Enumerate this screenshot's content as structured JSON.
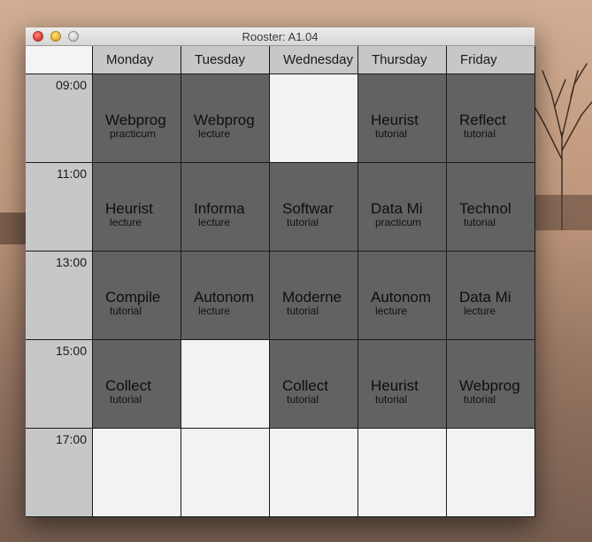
{
  "window": {
    "title": "Rooster: A1.04"
  },
  "days": [
    "Monday",
    "Tuesday",
    "Wednesday",
    "Thursday",
    "Friday"
  ],
  "times": [
    "09:00",
    "11:00",
    "13:00",
    "15:00",
    "17:00"
  ],
  "schedule": [
    [
      {
        "course": "Webprog",
        "kind": "practicum"
      },
      {
        "course": "Webprog",
        "kind": "lecture"
      },
      null,
      {
        "course": "Heurist",
        "kind": "tutorial"
      },
      {
        "course": "Reflect",
        "kind": "tutorial"
      }
    ],
    [
      {
        "course": "Heurist",
        "kind": "lecture"
      },
      {
        "course": "Informa",
        "kind": "lecture"
      },
      {
        "course": "Softwar",
        "kind": "tutorial"
      },
      {
        "course": "Data Mi",
        "kind": "practicum"
      },
      {
        "course": "Technol",
        "kind": "tutorial"
      }
    ],
    [
      {
        "course": "Compile",
        "kind": "tutorial"
      },
      {
        "course": "Autonom",
        "kind": "lecture"
      },
      {
        "course": "Moderne",
        "kind": "tutorial"
      },
      {
        "course": "Autonom",
        "kind": "lecture"
      },
      {
        "course": "Data Mi",
        "kind": "lecture"
      }
    ],
    [
      {
        "course": "Collect",
        "kind": "tutorial"
      },
      null,
      {
        "course": "Collect",
        "kind": "tutorial"
      },
      {
        "course": "Heurist",
        "kind": "tutorial"
      },
      {
        "course": "Webprog",
        "kind": "tutorial"
      }
    ],
    [
      null,
      null,
      null,
      null,
      null
    ]
  ],
  "colors": {
    "filled_slot": "#626262",
    "empty_slot": "#f2f2f2",
    "header": "#c7c7c7"
  }
}
